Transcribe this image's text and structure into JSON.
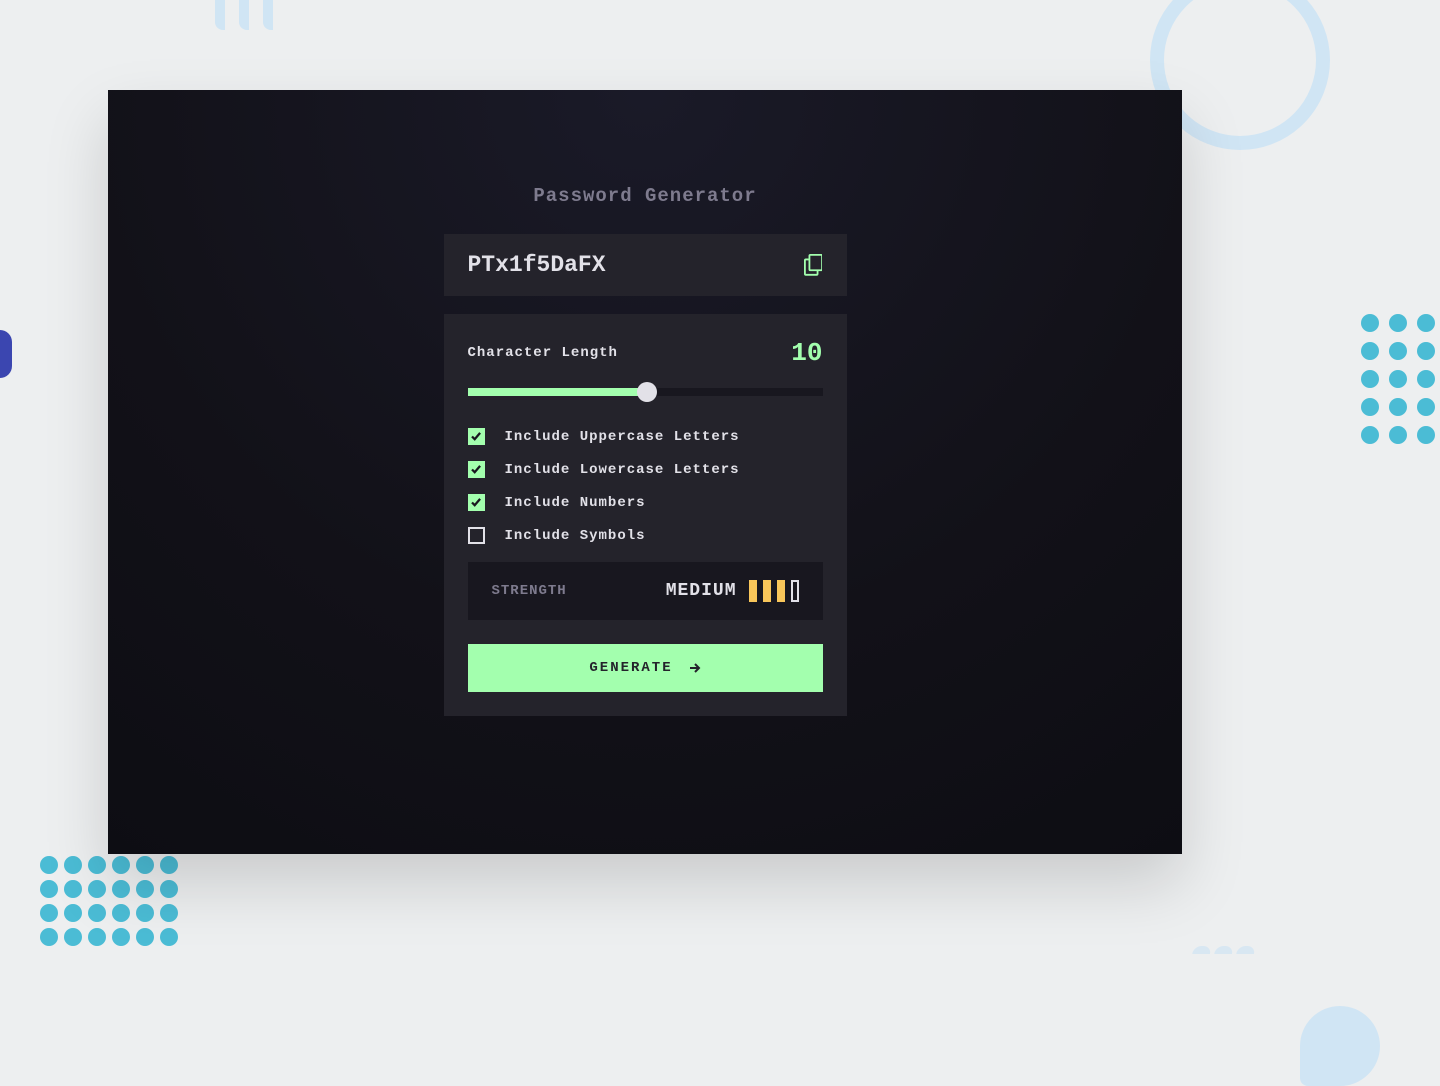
{
  "app": {
    "title": "Password Generator"
  },
  "output": {
    "password": "PTx1f5DaFX"
  },
  "options": {
    "length_label": "Character Length",
    "length_value": "10",
    "items": [
      {
        "label": "Include Uppercase Letters",
        "checked": true
      },
      {
        "label": "Include Lowercase Letters",
        "checked": true
      },
      {
        "label": "Include Numbers",
        "checked": true
      },
      {
        "label": "Include Symbols",
        "checked": false
      }
    ]
  },
  "strength": {
    "label": "STRENGTH",
    "value": "MEDIUM",
    "filled": 3,
    "total": 4
  },
  "generate": {
    "label": "GENERATE"
  },
  "colors": {
    "accent": "#a3ffae",
    "panel": "#24232b",
    "dark": "#18171f"
  }
}
